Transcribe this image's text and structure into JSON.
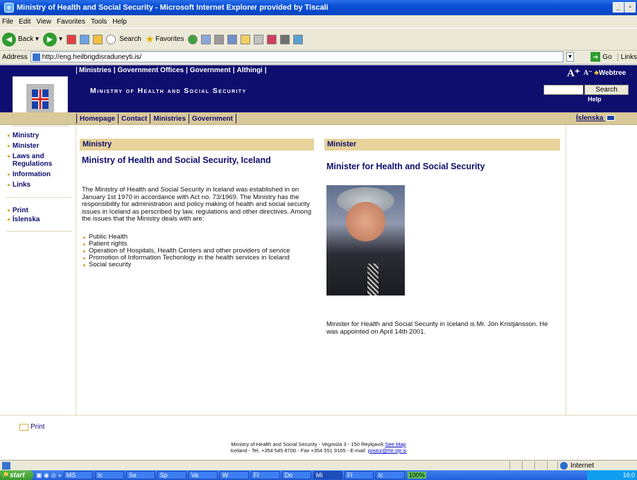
{
  "window": {
    "title": "Ministry of Health and Social Security - Microsoft Internet Explorer provided by Tiscali"
  },
  "menu": [
    "File",
    "Edit",
    "View",
    "Favorites",
    "Tools",
    "Help"
  ],
  "toolbar": {
    "back": "Back",
    "search": "Search",
    "favorites": "Favorites"
  },
  "address": {
    "label": "Address",
    "url": "http://eng.heilbrigdisraduneyti.is/",
    "go": "Go",
    "links": "Links"
  },
  "site": {
    "top_links": [
      "Ministries",
      "Government Offices",
      "Government",
      "Althingi"
    ],
    "title": "Ministry of Health and Social Security",
    "font_tools": "Webtree",
    "search_button": "Search",
    "help": "Help",
    "nav": [
      "Homepage",
      "Contact",
      "Ministries",
      "Government"
    ],
    "islenska_top": "Íslenska"
  },
  "left_nav": {
    "items": [
      "Ministry",
      "Minister",
      "Laws and Regulations",
      "Information",
      "Links"
    ],
    "tools": [
      "Print",
      "Íslenska"
    ]
  },
  "ministry": {
    "header": "Ministry",
    "heading": "Ministry of Health and Social Security, Iceland",
    "body": "The Ministry of Health and Social Security in Iceland was established in on January 1st 1970 in accordance with Act no. 73/1969. The Ministry has the responsibility for administration and policy making of health and social security issues in Iceland as perscribed by law, regulations and other directives. Among the issues that the Ministry deals with are:",
    "issues": [
      "Public Health",
      "Patient rights",
      "Operation of Hospitals, Health Centers and other providers of service",
      "Promotion of Information Techonlogy in the health services in Iceland",
      "Social security"
    ]
  },
  "minister": {
    "header": "Minister",
    "heading": "Minister for Health and Social Security",
    "caption": "Minister for Health and Social Security in Iceland is Mr. Jón Kristjánsson. He was appointed on April 14th 2001."
  },
  "footer": {
    "print": "Print",
    "line1": "Ministry of Health and Social Security - Vegmúla 3 - 150 Reykjavík",
    "see_map": "See Map",
    "line2": "Iceland - Tel. +354 545 8700 - Fax +354 551 9165 - E-mail:",
    "email": "postur@htr.stjr.is"
  },
  "status": {
    "zone": "Internet"
  },
  "taskbar": {
    "start": "start",
    "tasks": [
      "MS",
      "Ic",
      "Se",
      "Sp",
      "Va",
      "W",
      "Fl",
      "Do",
      "Mi",
      "Fl",
      "Ic"
    ],
    "zoom": "100%",
    "clock": "16:0"
  }
}
